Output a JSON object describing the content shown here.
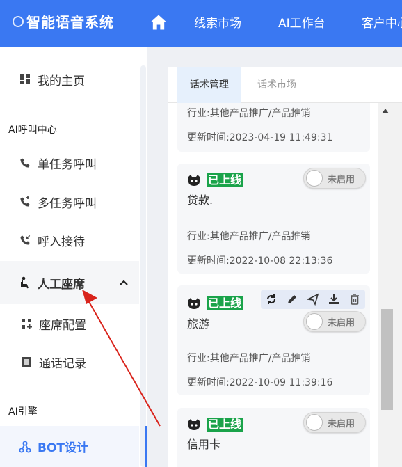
{
  "header": {
    "app_title": "智能语音系统",
    "nav_items": [
      "线索市场",
      "AI工作台",
      "客户中心"
    ]
  },
  "sidebar": {
    "home_label": "我的主页",
    "section_call": "AI呼叫中心",
    "single_call": "单任务呼叫",
    "multi_call": "多任务呼叫",
    "inbound": "呼入接待",
    "manual_seat": "人工座席",
    "seat_config": "座席配置",
    "call_records": "通话记录",
    "section_engine": "AI引擎",
    "bot_design": "BOT设计"
  },
  "tabs": {
    "active": "话术管理",
    "inactive": "话术市场"
  },
  "cards": [
    {
      "industry": "行业:其他产品推广/产品推销",
      "updated": "更新时间:2023-04-19 11:49:31"
    },
    {
      "status": "已上线",
      "title": "贷款.",
      "toggle": "未启用",
      "industry": "行业:其他产品推广/产品推销",
      "updated": "更新时间:2022-10-08 22:13:36"
    },
    {
      "status": "已上线",
      "title": "旅游",
      "toggle": "未启用",
      "industry": "行业:其他产品推广/产品推销",
      "updated": "更新时间:2022-10-09 11:39:16"
    },
    {
      "status": "已上线",
      "title": "信用卡",
      "toggle": "未启用"
    }
  ],
  "colors": {
    "primary": "#3a78f2",
    "status_green": "#1aa34a",
    "arrow_red": "#d9241c"
  },
  "icons": [
    "home-icon",
    "dashboard-icon",
    "phone-icon",
    "phone-forward-icon",
    "phone-incoming-icon",
    "seat-icon",
    "chevron-up-icon",
    "grid-plus-icon",
    "list-icon",
    "network-icon",
    "github-icon",
    "sync-icon",
    "edit-icon",
    "send-icon",
    "download-icon",
    "trash-icon"
  ]
}
